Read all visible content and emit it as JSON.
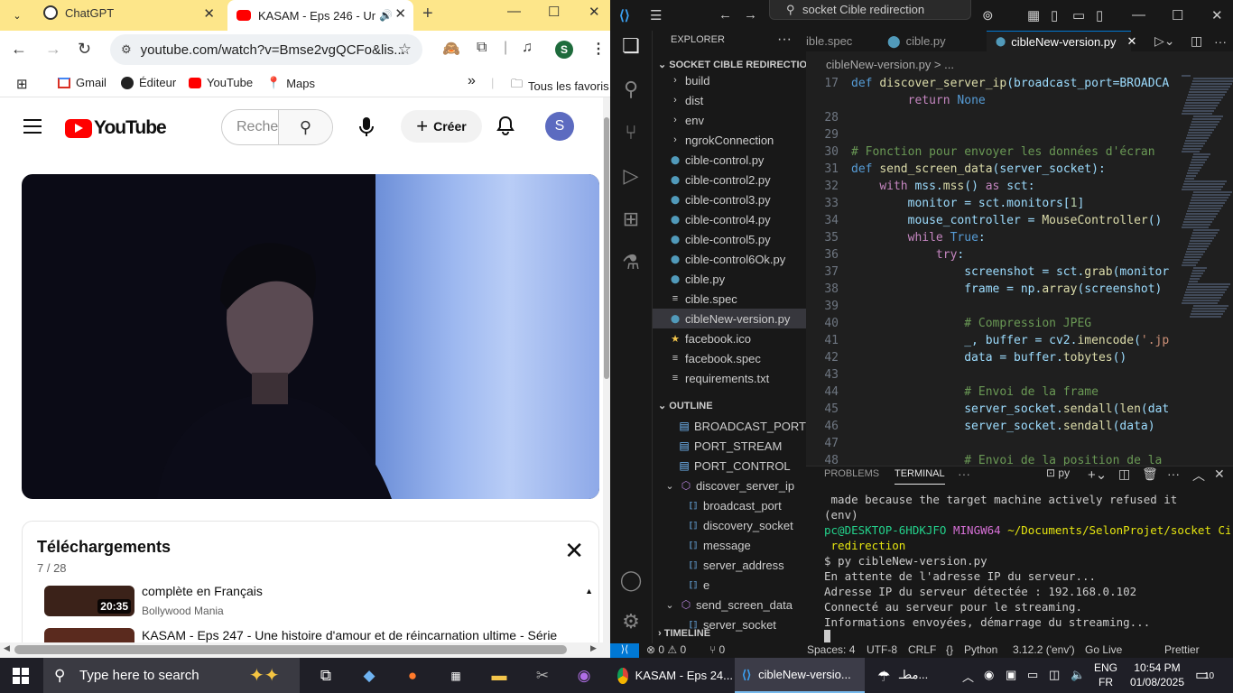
{
  "chrome": {
    "tabs": [
      {
        "title": "ChatGPT",
        "close": "✕"
      },
      {
        "title": "KASAM - Eps 246 - Un",
        "close": "✕"
      }
    ],
    "new_tab": "+",
    "window": {
      "minimize": "—",
      "maximize": "☐",
      "close": "✕"
    },
    "url": "youtube.com/watch?v=Bmse2vgQCFo&lis...",
    "profile_initial": "S",
    "bookmarks": [
      {
        "label": "Gmail"
      },
      {
        "label": "Éditeur"
      },
      {
        "label": "YouTube"
      },
      {
        "label": "Maps"
      }
    ],
    "bookmarks_more": "»",
    "all_bookmarks": "Tous les favoris"
  },
  "youtube": {
    "logo": "YouTube",
    "search_placeholder": "Reche",
    "create_label": "Créer",
    "avatar_initial": "S",
    "downloads": {
      "title": "Téléchargements",
      "count": "7 / 28",
      "items": [
        {
          "title": "complète en Français",
          "channel": "Bollywood Mania",
          "duration": "20:35"
        },
        {
          "title": "KASAM - Eps 247 - Une histoire d'amour et de réincarnation ultime - Série",
          "channel": "",
          "duration": ""
        }
      ]
    }
  },
  "vscode": {
    "search": "socket Cible redirection",
    "explorer_title": "EXPLORER",
    "project": "SOCKET CIBLE REDIRECTION",
    "tree": [
      {
        "name": "build",
        "type": "folder"
      },
      {
        "name": "dist",
        "type": "folder"
      },
      {
        "name": "env",
        "type": "folder"
      },
      {
        "name": "ngrokConnection",
        "type": "folder"
      },
      {
        "name": "cible-control.py",
        "type": "py"
      },
      {
        "name": "cible-control2.py",
        "type": "py"
      },
      {
        "name": "cible-control3.py",
        "type": "py"
      },
      {
        "name": "cible-control4.py",
        "type": "py"
      },
      {
        "name": "cible-control5.py",
        "type": "py"
      },
      {
        "name": "cible-control6Ok.py",
        "type": "py"
      },
      {
        "name": "cible.py",
        "type": "py"
      },
      {
        "name": "cible.spec",
        "type": "spec"
      },
      {
        "name": "cibleNew-version.py",
        "type": "py",
        "selected": true
      },
      {
        "name": "facebook.ico",
        "type": "ico"
      },
      {
        "name": "facebook.spec",
        "type": "spec"
      },
      {
        "name": "requirements.txt",
        "type": "txt"
      }
    ],
    "outline_title": "OUTLINE",
    "outline": [
      {
        "name": "BROADCAST_PORT",
        "kind": "const"
      },
      {
        "name": "PORT_STREAM",
        "kind": "const"
      },
      {
        "name": "PORT_CONTROL",
        "kind": "const"
      },
      {
        "name": "discover_server_ip",
        "kind": "func"
      },
      {
        "name": "broadcast_port",
        "kind": "var"
      },
      {
        "name": "discovery_socket",
        "kind": "var"
      },
      {
        "name": "message",
        "kind": "var"
      },
      {
        "name": "server_address",
        "kind": "var"
      },
      {
        "name": "e",
        "kind": "var"
      },
      {
        "name": "send_screen_data",
        "kind": "func"
      },
      {
        "name": "server_socket",
        "kind": "var"
      }
    ],
    "timeline_title": "TIMELINE",
    "editor_tabs": [
      {
        "label": "ible.spec"
      },
      {
        "label": "cible.py"
      },
      {
        "label": "cibleNew-version.py"
      }
    ],
    "breadcrumb": "cibleNew-version.py > ...",
    "code_lines": [
      {
        "n": "17",
        "t": "def discover_server_ip(broadcast_port=BROADCA"
      },
      {
        "n": "",
        "t": "        return None"
      },
      {
        "n": "28",
        "t": ""
      },
      {
        "n": "29",
        "t": ""
      },
      {
        "n": "30",
        "t": "# Fonction pour envoyer les données d'écran"
      },
      {
        "n": "31",
        "t": "def send_screen_data(server_socket):"
      },
      {
        "n": "32",
        "t": "    with mss.mss() as sct:"
      },
      {
        "n": "33",
        "t": "        monitor = sct.monitors[1]"
      },
      {
        "n": "34",
        "t": "        mouse_controller = MouseController()"
      },
      {
        "n": "35",
        "t": "        while True:"
      },
      {
        "n": "36",
        "t": "            try:"
      },
      {
        "n": "37",
        "t": "                screenshot = sct.grab(monitor"
      },
      {
        "n": "38",
        "t": "                frame = np.array(screenshot)"
      },
      {
        "n": "39",
        "t": ""
      },
      {
        "n": "40",
        "t": "                # Compression JPEG"
      },
      {
        "n": "41",
        "t": "                _, buffer = cv2.imencode('.jp"
      },
      {
        "n": "42",
        "t": "                data = buffer.tobytes()"
      },
      {
        "n": "43",
        "t": ""
      },
      {
        "n": "44",
        "t": "                # Envoi de la frame"
      },
      {
        "n": "45",
        "t": "                server_socket.sendall(len(dat"
      },
      {
        "n": "46",
        "t": "                server_socket.sendall(data)"
      },
      {
        "n": "47",
        "t": ""
      },
      {
        "n": "48",
        "t": "                # Envoi de la position de la"
      }
    ],
    "panel_tabs": [
      "PROBLEMS",
      "TERMINAL"
    ],
    "terminal_shell": "py",
    "terminal": {
      "l1": " made because the target machine actively refused it",
      "l2": "(env)",
      "prompt_user": "pc@DESKTOP-6HDKJFO",
      "prompt_env": "MINGW64",
      "prompt_path": "~/Documents/SelonProjet/socket Cible",
      "prompt_path2": " redirection",
      "cmd": "$ py cibleNew-version.py",
      "o1": "En attente de l'adresse IP du serveur...",
      "o2": "Adresse IP du serveur détectée : 192.168.0.102",
      "o3": "Connecté au serveur pour le streaming.",
      "o4": "Informations envoyées, démarrage du streaming..."
    },
    "status": {
      "errors": "⊗ 0 ⚠ 0",
      "ports": "⑂ 0",
      "spaces": "Spaces: 4",
      "encoding": "UTF-8",
      "eol": "CRLF",
      "braces": "{}",
      "lang": "Python",
      "interp": "3.12.2 ('env')",
      "golive": "Go Live",
      "prettier": "Prettier"
    }
  },
  "taskbar": {
    "search_placeholder": "Type here to search",
    "windows": [
      {
        "label": "KASAM - Eps 24..."
      },
      {
        "label": "cibleNew-versio..."
      }
    ],
    "weather": "مطـ...",
    "lang": "ENG",
    "region": "FR",
    "time": "10:54 PM",
    "date": "01/08/2025",
    "notif_count": "10"
  }
}
